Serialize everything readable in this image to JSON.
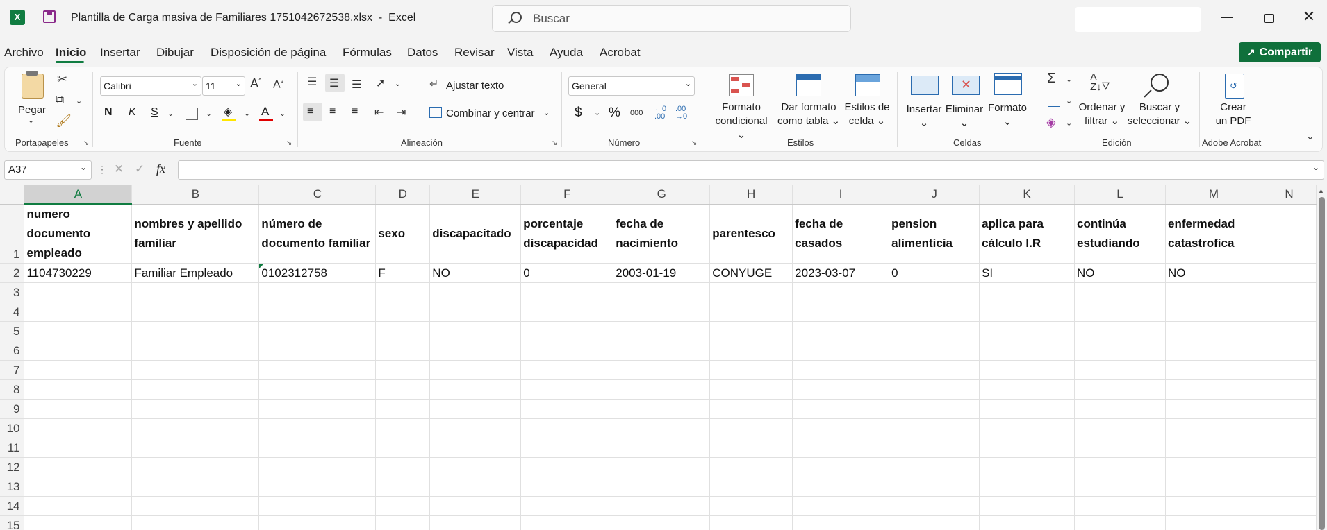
{
  "titlebar": {
    "file_name": "Plantilla de Carga masiva de Familiares 1751042672538.xlsx",
    "app_sep": "-",
    "app_name": "Excel",
    "search_placeholder": "Buscar"
  },
  "menu": {
    "items": [
      "Archivo",
      "Inicio",
      "Insertar",
      "Dibujar",
      "Disposición de página",
      "Fórmulas",
      "Datos",
      "Revisar",
      "Vista",
      "Ayuda",
      "Acrobat"
    ],
    "active": "Inicio",
    "share_label": "Compartir"
  },
  "ribbon": {
    "clipboard": {
      "paste_label": "Pegar",
      "group_label": "Portapapeles"
    },
    "font": {
      "name": "Calibri",
      "size": "11",
      "bold": "N",
      "italic": "K",
      "underline": "S",
      "group_label": "Fuente"
    },
    "alignment": {
      "wrap_label": "Ajustar texto",
      "merge_label": "Combinar y centrar",
      "group_label": "Alineación"
    },
    "number": {
      "format": "General",
      "group_label": "Número",
      "currency": "$",
      "percent": "%",
      "thousands": "000"
    },
    "styles": {
      "cond_format_1": "Formato",
      "cond_format_2": "condicional",
      "table_format_1": "Dar formato",
      "table_format_2": "como tabla",
      "cell_styles_1": "Estilos de",
      "cell_styles_2": "celda",
      "group_label": "Estilos"
    },
    "cells": {
      "insert_label": "Insertar",
      "delete_label": "Eliminar",
      "format_label": "Formato",
      "group_label": "Celdas"
    },
    "editing": {
      "sort_1": "Ordenar y",
      "sort_2": "filtrar",
      "find_1": "Buscar y",
      "find_2": "seleccionar",
      "group_label": "Edición"
    },
    "acrobat": {
      "pdf_1": "Crear",
      "pdf_2": "un PDF",
      "group_label": "Adobe Acrobat"
    }
  },
  "formula_bar": {
    "name_box": "A37",
    "fx": "fx",
    "formula": ""
  },
  "sheet": {
    "columns": [
      "A",
      "B",
      "C",
      "D",
      "E",
      "F",
      "G",
      "H",
      "I",
      "J",
      "K",
      "L",
      "M",
      "N"
    ],
    "selected_column": "A",
    "header_row": [
      "numero documento empleado",
      "nombres y apellido familiar",
      "número de documento familiar",
      "sexo",
      "discapacitado",
      "porcentaje discapacidad",
      "fecha de nacimiento",
      "parentesco",
      "fecha de casados",
      "pension alimenticia",
      "aplica para cálculo I.R",
      "continúa estudiando",
      "enfermedad catastrofica",
      ""
    ],
    "data_rows": [
      [
        "1104730229",
        "Familiar Empleado",
        "0102312758",
        "F",
        "NO",
        "0",
        "2003-01-19",
        "CONYUGE",
        "2023-03-07",
        "0",
        "SI",
        "NO",
        "NO",
        ""
      ]
    ],
    "row_numbers": [
      "1",
      "2",
      "3",
      "4",
      "5",
      "6",
      "7",
      "8",
      "9",
      "10",
      "11",
      "12",
      "13",
      "14",
      "15"
    ]
  },
  "colors": {
    "accent": "#107c41",
    "share_bg": "#0f703b"
  }
}
